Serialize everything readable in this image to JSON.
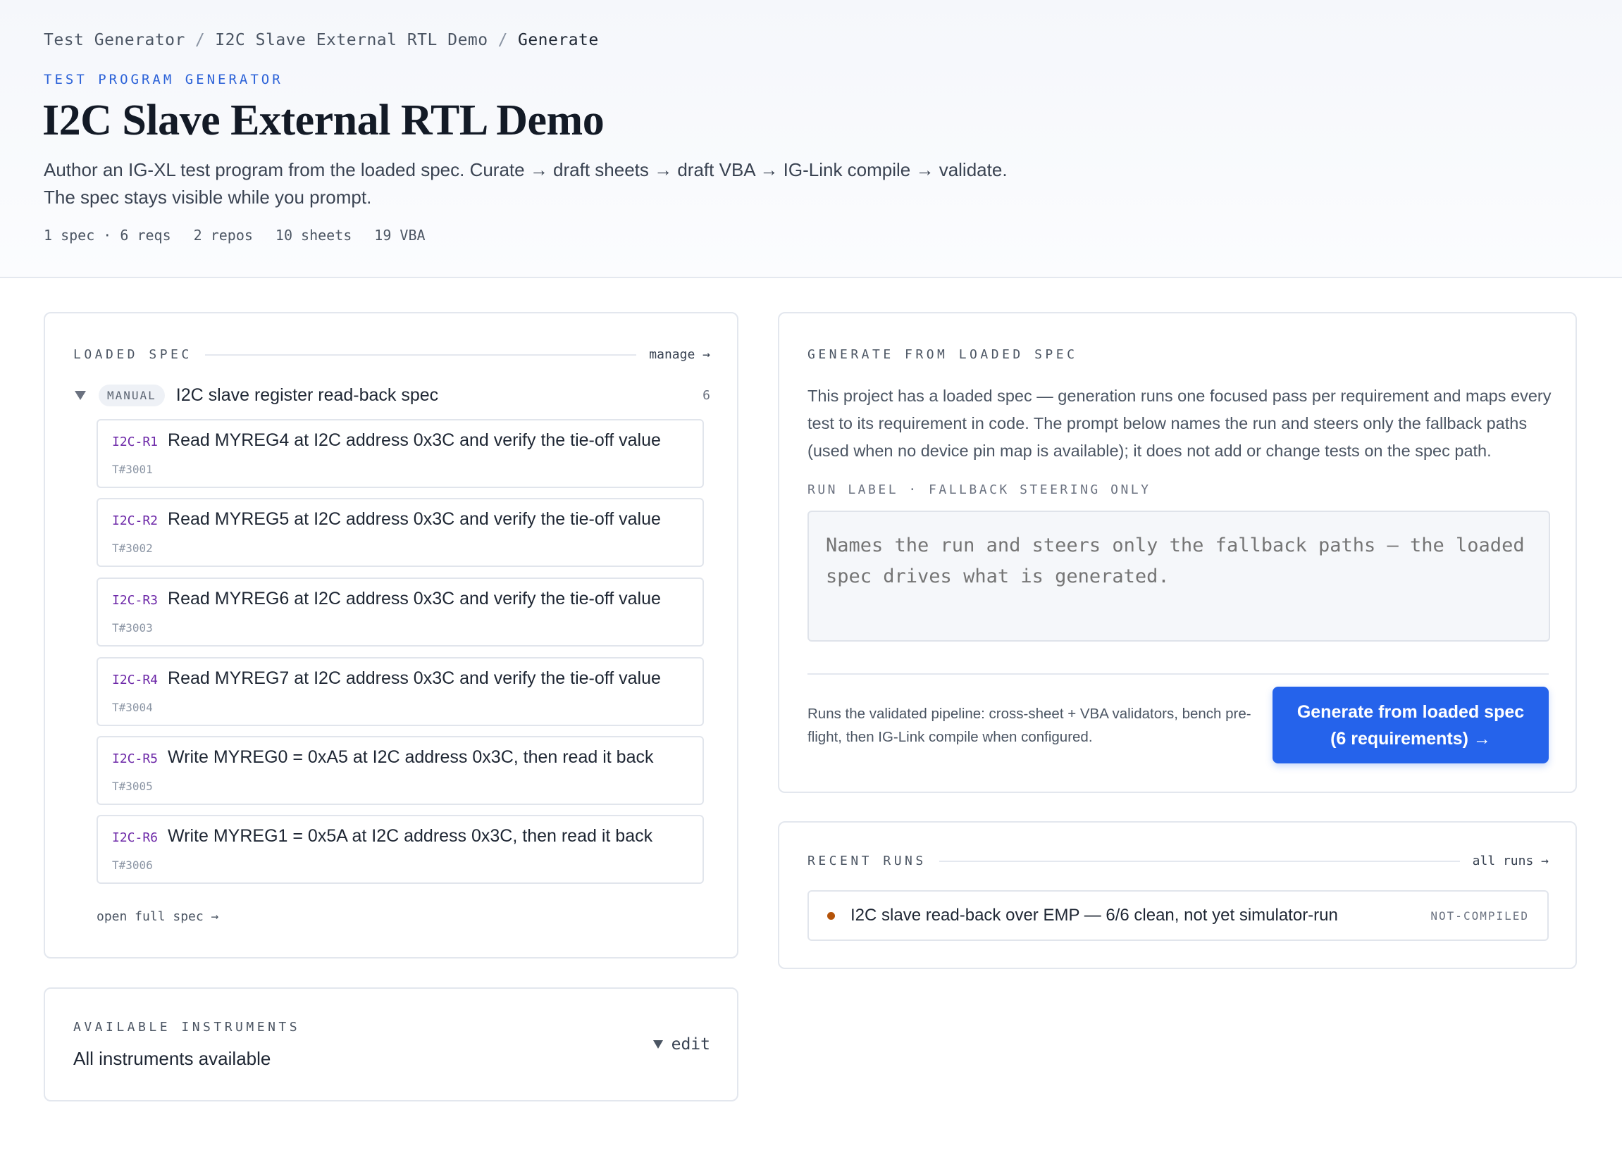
{
  "breadcrumb": [
    "Test Generator",
    "I2C Slave External RTL Demo",
    "Generate"
  ],
  "breadcrumb_separator": "/",
  "header": {
    "eyebrow": "TEST PROGRAM GENERATOR",
    "title": "I2C Slave External RTL Demo",
    "subtitle_line1": "Author an IG-XL test program from the loaded spec. Curate → draft sheets → draft VBA → IG-Link compile → validate.",
    "subtitle_line2": "The spec stays visible while you prompt.",
    "stats": [
      "1 spec · 6 reqs",
      "2 repos",
      "10 sheets",
      "19 VBA"
    ]
  },
  "loaded_spec": {
    "label": "LOADED SPEC",
    "manage_link": "manage →",
    "badge": "MANUAL",
    "spec_name": "I2C slave register read-back spec",
    "count": "6",
    "requirements": [
      {
        "id": "I2C-R1",
        "text": "Read MYREG4 at I2C address 0x3C and verify the tie-off value",
        "test": "T#3001"
      },
      {
        "id": "I2C-R2",
        "text": "Read MYREG5 at I2C address 0x3C and verify the tie-off value",
        "test": "T#3002"
      },
      {
        "id": "I2C-R3",
        "text": "Read MYREG6 at I2C address 0x3C and verify the tie-off value",
        "test": "T#3003"
      },
      {
        "id": "I2C-R4",
        "text": "Read MYREG7 at I2C address 0x3C and verify the tie-off value",
        "test": "T#3004"
      },
      {
        "id": "I2C-R5",
        "text": "Write MYREG0 = 0xA5 at I2C address 0x3C, then read it back",
        "test": "T#3005"
      },
      {
        "id": "I2C-R6",
        "text": "Write MYREG1 = 0x5A at I2C address 0x3C, then read it back",
        "test": "T#3006"
      }
    ],
    "open_full_spec": "open full spec →"
  },
  "instruments": {
    "label": "AVAILABLE INSTRUMENTS",
    "value": "All instruments available",
    "edit": "edit"
  },
  "generate": {
    "label": "GENERATE FROM LOADED SPEC",
    "description": "This project has a loaded spec — generation runs one focused pass per requirement and maps every test to its requirement in code. The prompt below names the run and steers only the fallback paths (used when no device pin map is available); it does not add or change tests on the spec path.",
    "run_label": "RUN LABEL · FALLBACK STEERING ONLY",
    "placeholder": "Names the run and steers only the fallback paths — the loaded spec drives what is generated.",
    "note": "Runs the validated pipeline: cross-sheet + VBA validators, bench pre-flight, then IG-Link compile when configured.",
    "button_line1": "Generate from loaded spec",
    "button_line2": "(6 requirements) →"
  },
  "recent_runs": {
    "label": "RECENT RUNS",
    "all_runs": "all runs →",
    "items": [
      {
        "text": "I2C slave read-back over EMP — 6/6 clean, not yet simulator-run",
        "status": "NOT-COMPILED"
      }
    ]
  },
  "colors": {
    "accent": "#2563eb",
    "req_id": "#6d28a8",
    "status_dot": "#b45309"
  }
}
